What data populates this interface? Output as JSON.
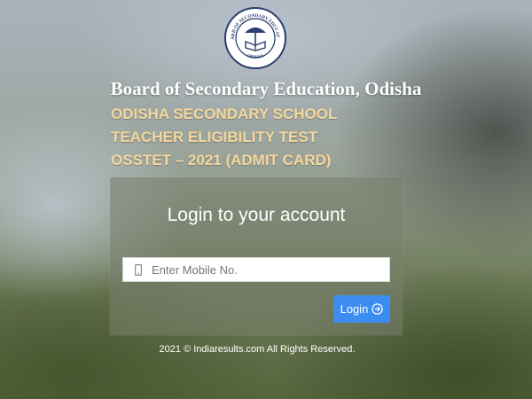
{
  "header": {
    "logo_icon": "board-seal-icon",
    "logo_text_top": "BOARD OF SECONDARY EDUCATION",
    "logo_text_bottom": "ORISSA",
    "board_name": "Board of Secondary Education, Odisha"
  },
  "exam": {
    "lines": [
      "ODISHA SECONDARY SCHOOL",
      "TEACHER ELIGIBILITY TEST",
      "OSSTET – 2021 (ADMIT CARD)"
    ],
    "title_color": "#f5d79c"
  },
  "login": {
    "heading": "Login to your account",
    "mobile_placeholder": "Enter Mobile No.",
    "mobile_value": "",
    "mobile_icon": "mobile-phone-icon",
    "button_label": "Login",
    "button_icon": "arrow-right-circle-icon",
    "button_color": "#3d8df0"
  },
  "footer": {
    "text": "2021 © Indiaresults.com All Rights Reserved."
  }
}
